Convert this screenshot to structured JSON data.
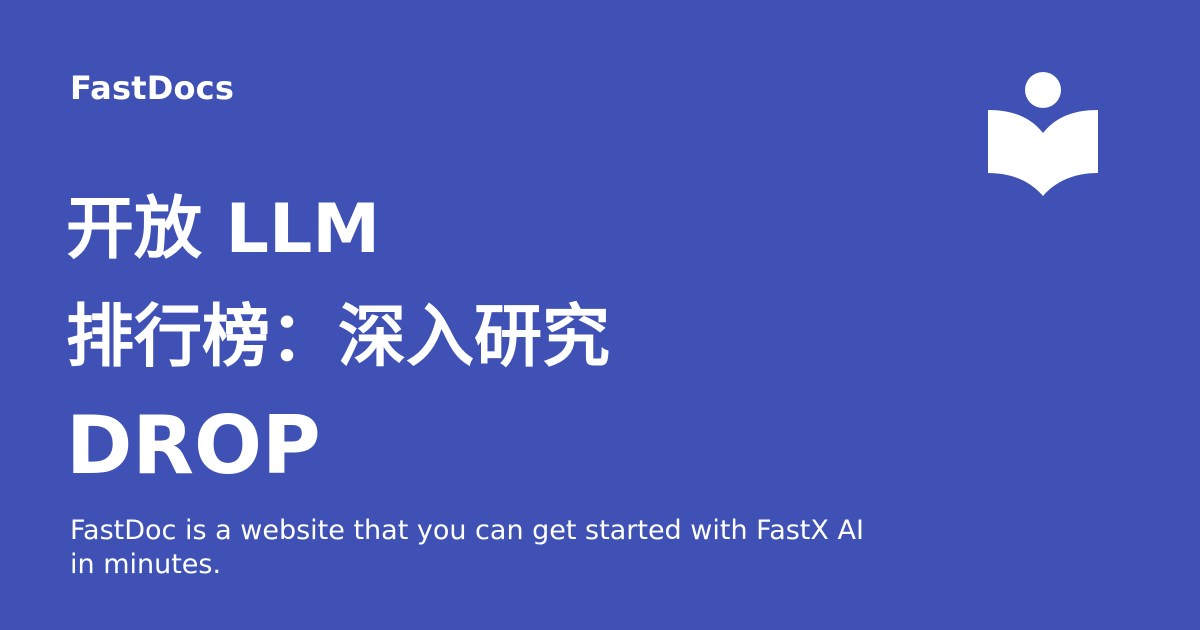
{
  "brand": {
    "name": "FastDocs"
  },
  "logo": {
    "icon": "reader-book-icon",
    "color": "#ffffff"
  },
  "title": {
    "line1": "开放 LLM",
    "line2": "排行榜：深入研究",
    "line3": "DROP"
  },
  "description": {
    "text": "FastDoc is a website that you can get started with FastX AI in minutes."
  },
  "theme": {
    "background": "#3f51b5",
    "text": "#ffffff"
  }
}
